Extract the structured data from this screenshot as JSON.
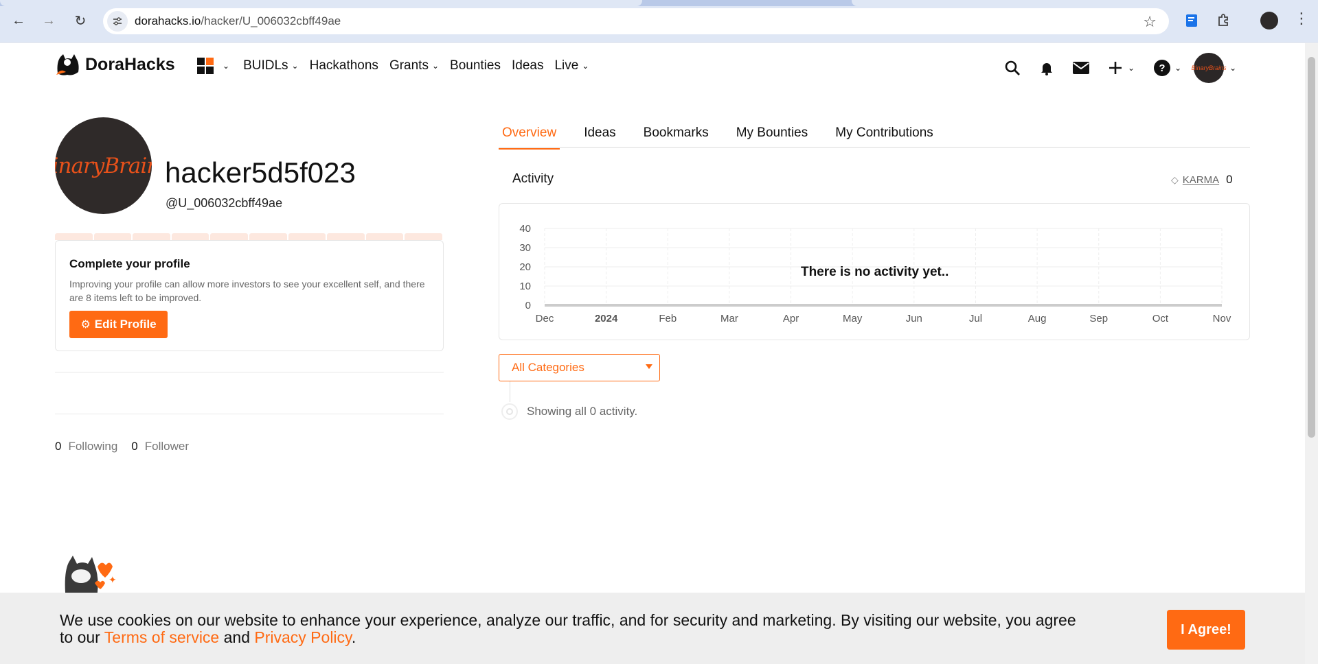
{
  "browser": {
    "url_domain": "dorahacks.io",
    "url_path": "/hacker/U_006032cbff49ae"
  },
  "header": {
    "logo_text": "DoraHacks",
    "menu": [
      {
        "label": "BUIDLs",
        "has_dropdown": true
      },
      {
        "label": "Hackathons",
        "has_dropdown": false
      },
      {
        "label": "Grants",
        "has_dropdown": true
      },
      {
        "label": "Bounties",
        "has_dropdown": false
      },
      {
        "label": "Ideas",
        "has_dropdown": false
      },
      {
        "label": "Live",
        "has_dropdown": true
      }
    ],
    "icons": [
      "search-icon",
      "bell-icon",
      "mail-icon",
      "plus-icon",
      "help-icon"
    ],
    "avatar_text": "BinaryBrains"
  },
  "profile": {
    "avatar_text": "BinaryBrains",
    "username": "hacker5d5f023",
    "handle": "@U_006032cbff49ae",
    "complete_title": "Complete your profile",
    "complete_desc": "Improving your profile can allow more investors to see your excellent self, and there are 8 items left to be improved.",
    "edit_button": "Edit Profile",
    "following_count": "0",
    "following_label": "Following",
    "follower_count": "0",
    "follower_label": "Follower"
  },
  "tabs": [
    {
      "label": "Overview",
      "active": true
    },
    {
      "label": "Ideas",
      "active": false
    },
    {
      "label": "Bookmarks",
      "active": false
    },
    {
      "label": "My Bounties",
      "active": false
    },
    {
      "label": "My Contributions",
      "active": false
    }
  ],
  "activity": {
    "title": "Activity",
    "karma_label": "KARMA",
    "karma_value": "0",
    "empty_text": "There is no activity yet..",
    "category_value": "All Categories",
    "showing_text": "Showing all 0 activity."
  },
  "chart_data": {
    "type": "line",
    "x": [
      "Dec",
      "2024",
      "Feb",
      "Mar",
      "Apr",
      "May",
      "Jun",
      "Jul",
      "Aug",
      "Sep",
      "Oct",
      "Nov"
    ],
    "y_ticks": [
      "40",
      "30",
      "20",
      "10",
      "0"
    ],
    "series": [
      {
        "values": [
          0,
          0,
          0,
          0,
          0,
          0,
          0,
          0,
          0,
          0,
          0,
          0
        ]
      }
    ],
    "ylim": [
      0,
      40
    ],
    "grid": true
  },
  "cookie": {
    "text_before": "We use cookies on our website to enhance your experience, analyze our traffic, and for security and marketing. By visiting our website, you agree to our ",
    "terms_link": "Terms of service",
    "and_text": " and ",
    "privacy_link": "Privacy Policy",
    "end_text": ".",
    "agree_button": "I Agree!"
  },
  "colors": {
    "accent": "#ff6a13",
    "avatar_bg": "#2f2a29"
  }
}
